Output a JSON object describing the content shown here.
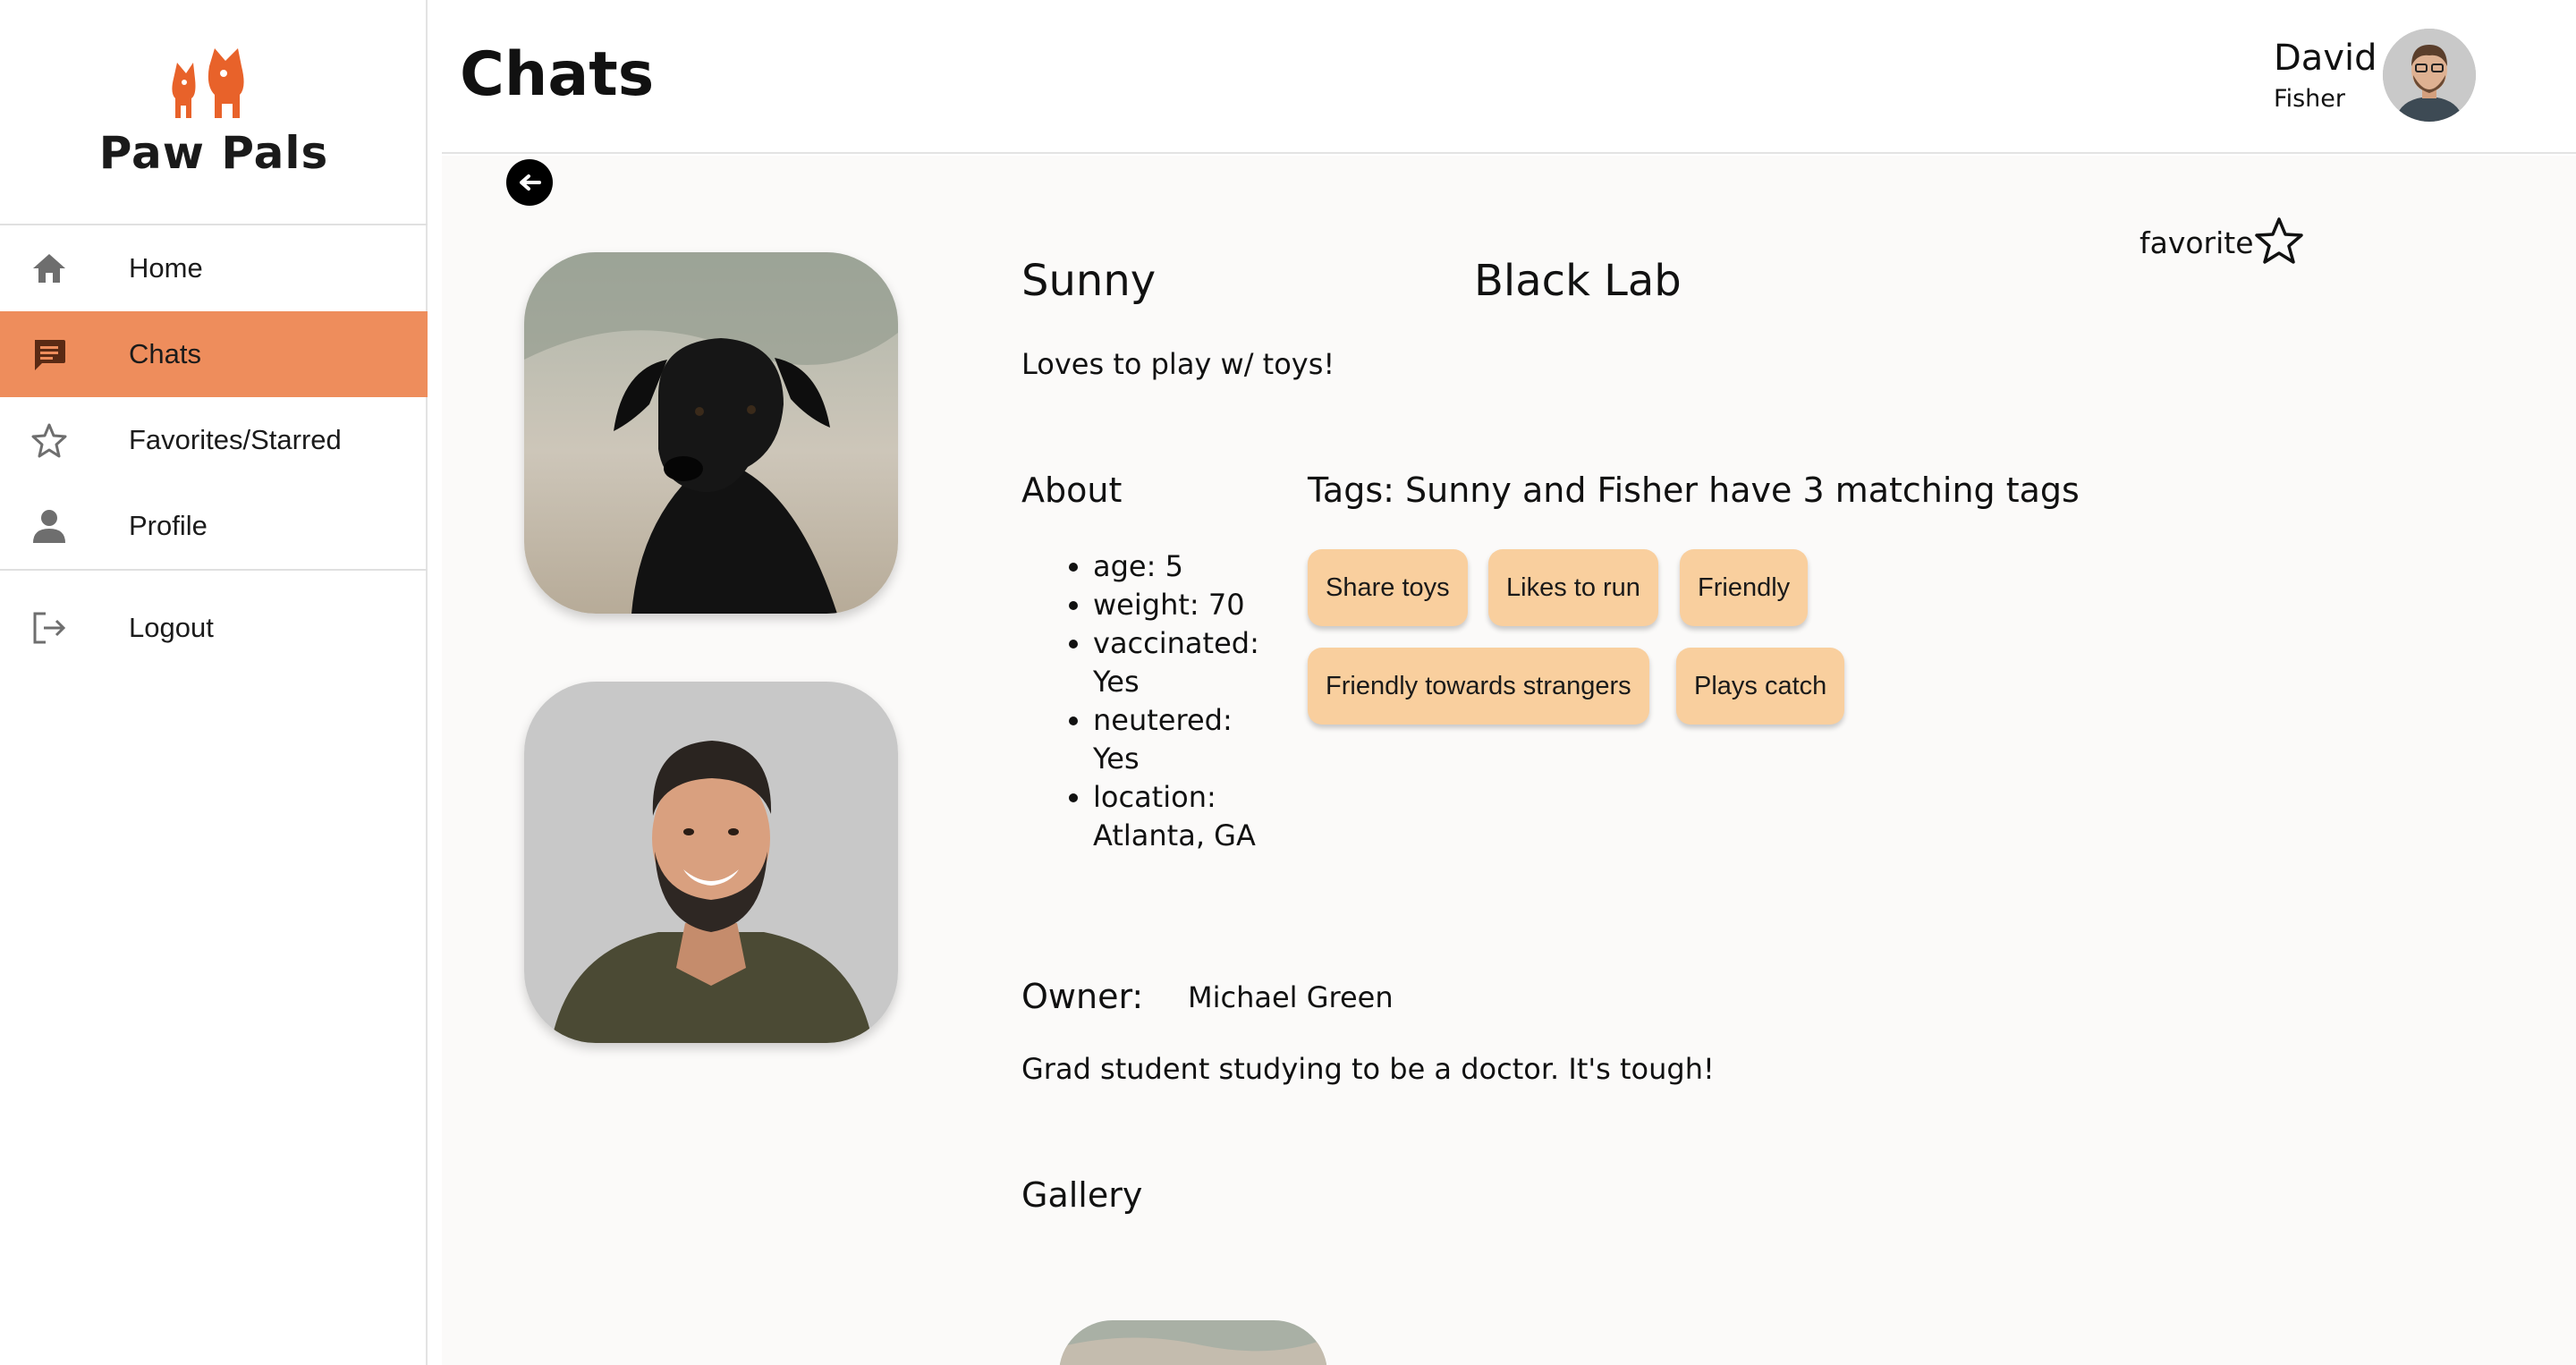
{
  "app": {
    "name": "Paw Pals",
    "brand_color": "#e8622a",
    "active_color": "#ee8d5c",
    "tag_color": "#f9cf9e"
  },
  "sidebar": {
    "items": [
      {
        "label": "Home",
        "icon": "home-icon"
      },
      {
        "label": "Chats",
        "icon": "chat-icon",
        "active": true
      },
      {
        "label": "Favorites/Starred",
        "icon": "star-outline-icon"
      },
      {
        "label": "Profile",
        "icon": "person-icon"
      },
      {
        "label": "Logout",
        "icon": "logout-icon"
      }
    ]
  },
  "header": {
    "title": "Chats",
    "user": {
      "first_name": "David",
      "last_name": "Fisher"
    }
  },
  "dog": {
    "name": "Sunny",
    "breed": "Black Lab",
    "bio": "Loves to play w/ toys!",
    "favorite_label": "favorite",
    "about_title": "About",
    "about": [
      "age: 5",
      "weight: 70",
      "vaccinated: Yes",
      "neutered: Yes",
      "location: Atlanta, GA"
    ],
    "tags_title": "Tags: Sunny and Fisher have 3 matching tags",
    "tags": [
      "Share toys",
      "Likes to run",
      "Friendly",
      "Friendly towards strangers",
      "Plays catch"
    ]
  },
  "owner": {
    "label": "Owner:",
    "name": "Michael Green",
    "bio": "Grad student studying to be a doctor. It's tough!"
  },
  "gallery": {
    "title": "Gallery"
  }
}
